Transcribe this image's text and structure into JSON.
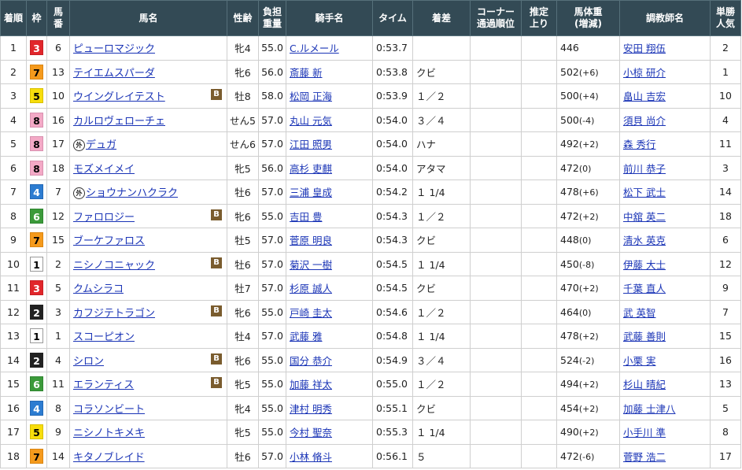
{
  "headers": {
    "rank": "着順",
    "waku": "枠",
    "umaban": "馬\n番",
    "horse": "馬名",
    "sexage": "性齢",
    "weight_carried": "負担\n重量",
    "jockey": "騎手名",
    "time": "タイム",
    "margin": "着差",
    "corner": "コーナー\n通過順位",
    "last3f": "推定\n上り",
    "body_weight": "馬体重\n(増減)",
    "trainer": "調教師名",
    "odds_pop": "単勝\n人気"
  },
  "rows": [
    {
      "rank": "1",
      "waku": "3",
      "umaban": "6",
      "horse": "ピューロマジック",
      "blinker": false,
      "foreign": false,
      "sexage": "牝4",
      "kinryo": "55.0",
      "jockey": "C.ルメール",
      "time": "0:53.7",
      "margin": "",
      "weight": "446",
      "change": "",
      "trainer": "安田 翔伍",
      "pop": "2"
    },
    {
      "rank": "2",
      "waku": "7",
      "umaban": "13",
      "horse": "テイエムスパーダ",
      "blinker": false,
      "foreign": false,
      "sexage": "牝6",
      "kinryo": "56.0",
      "jockey": "斎藤 新",
      "time": "0:53.8",
      "margin": "クビ",
      "weight": "502",
      "change": "(+6)",
      "trainer": "小椋 研介",
      "pop": "1"
    },
    {
      "rank": "3",
      "waku": "5",
      "umaban": "10",
      "horse": "ウイングレイテスト",
      "blinker": true,
      "foreign": false,
      "sexage": "牡8",
      "kinryo": "58.0",
      "jockey": "松岡 正海",
      "time": "0:53.9",
      "margin": "１／２",
      "weight": "500",
      "change": "(+4)",
      "trainer": "畠山 吉宏",
      "pop": "10"
    },
    {
      "rank": "4",
      "waku": "8",
      "umaban": "16",
      "horse": "カルロヴェローチェ",
      "blinker": false,
      "foreign": false,
      "sexage": "せん5",
      "kinryo": "57.0",
      "jockey": "丸山 元気",
      "time": "0:54.0",
      "margin": "３／４",
      "weight": "500",
      "change": "(-4)",
      "trainer": "須貝 尚介",
      "pop": "4"
    },
    {
      "rank": "5",
      "waku": "8",
      "umaban": "17",
      "horse": "デュガ",
      "blinker": false,
      "foreign": true,
      "sexage": "せん6",
      "kinryo": "57.0",
      "jockey": "江田 照男",
      "time": "0:54.0",
      "margin": "ハナ",
      "weight": "492",
      "change": "(+2)",
      "trainer": "森 秀行",
      "pop": "11"
    },
    {
      "rank": "6",
      "waku": "8",
      "umaban": "18",
      "horse": "モズメイメイ",
      "blinker": false,
      "foreign": false,
      "sexage": "牝5",
      "kinryo": "56.0",
      "jockey": "高杉 吏麒",
      "time": "0:54.0",
      "margin": "アタマ",
      "weight": "472",
      "change": "(0)",
      "trainer": "前川 恭子",
      "pop": "3"
    },
    {
      "rank": "7",
      "waku": "4",
      "umaban": "7",
      "horse": "ショウナンハクラク",
      "blinker": false,
      "foreign": true,
      "sexage": "牡6",
      "kinryo": "57.0",
      "jockey": "三浦 皇成",
      "time": "0:54.2",
      "margin": "１ 1/4",
      "weight": "478",
      "change": "(+6)",
      "trainer": "松下 武士",
      "pop": "14"
    },
    {
      "rank": "8",
      "waku": "6",
      "umaban": "12",
      "horse": "ファロロジー",
      "blinker": true,
      "foreign": false,
      "sexage": "牝6",
      "kinryo": "55.0",
      "jockey": "吉田 豊",
      "time": "0:54.3",
      "margin": "１／２",
      "weight": "472",
      "change": "(+2)",
      "trainer": "中舘 英二",
      "pop": "18"
    },
    {
      "rank": "9",
      "waku": "7",
      "umaban": "15",
      "horse": "ブーケファロス",
      "blinker": false,
      "foreign": false,
      "sexage": "牡5",
      "kinryo": "57.0",
      "jockey": "菅原 明良",
      "time": "0:54.3",
      "margin": "クビ",
      "weight": "448",
      "change": "(0)",
      "trainer": "清水 英克",
      "pop": "6"
    },
    {
      "rank": "10",
      "waku": "1",
      "umaban": "2",
      "horse": "ニシノコニャック",
      "blinker": true,
      "foreign": false,
      "sexage": "牡6",
      "kinryo": "57.0",
      "jockey": "菊沢 一樹",
      "time": "0:54.5",
      "margin": "１ 1/4",
      "weight": "450",
      "change": "(-8)",
      "trainer": "伊藤 大士",
      "pop": "12"
    },
    {
      "rank": "11",
      "waku": "3",
      "umaban": "5",
      "horse": "クムシラコ",
      "blinker": false,
      "foreign": false,
      "sexage": "牡7",
      "kinryo": "57.0",
      "jockey": "杉原 誠人",
      "time": "0:54.5",
      "margin": "クビ",
      "weight": "470",
      "change": "(+2)",
      "trainer": "千葉 直人",
      "pop": "9"
    },
    {
      "rank": "12",
      "waku": "2",
      "umaban": "3",
      "horse": "カフジテトラゴン",
      "blinker": true,
      "foreign": false,
      "sexage": "牝6",
      "kinryo": "55.0",
      "jockey": "戸崎 圭太",
      "time": "0:54.6",
      "margin": "１／２",
      "weight": "464",
      "change": "(0)",
      "trainer": "武 英智",
      "pop": "7"
    },
    {
      "rank": "13",
      "waku": "1",
      "umaban": "1",
      "horse": "スコーピオン",
      "blinker": false,
      "foreign": false,
      "sexage": "牡4",
      "kinryo": "57.0",
      "jockey": "武藤 雅",
      "time": "0:54.8",
      "margin": "１ 1/4",
      "weight": "478",
      "change": "(+2)",
      "trainer": "武藤 善則",
      "pop": "15"
    },
    {
      "rank": "14",
      "waku": "2",
      "umaban": "4",
      "horse": "シロン",
      "blinker": true,
      "foreign": false,
      "sexage": "牝6",
      "kinryo": "55.0",
      "jockey": "国分 恭介",
      "time": "0:54.9",
      "margin": "３／４",
      "weight": "524",
      "change": "(-2)",
      "trainer": "小栗 実",
      "pop": "16"
    },
    {
      "rank": "15",
      "waku": "6",
      "umaban": "11",
      "horse": "エランティス",
      "blinker": true,
      "foreign": false,
      "sexage": "牝5",
      "kinryo": "55.0",
      "jockey": "加藤 祥太",
      "time": "0:55.0",
      "margin": "１／２",
      "weight": "494",
      "change": "(+2)",
      "trainer": "杉山 晴紀",
      "pop": "13"
    },
    {
      "rank": "16",
      "waku": "4",
      "umaban": "8",
      "horse": "コラソンビート",
      "blinker": false,
      "foreign": false,
      "sexage": "牝4",
      "kinryo": "55.0",
      "jockey": "津村 明秀",
      "time": "0:55.1",
      "margin": "クビ",
      "weight": "454",
      "change": "(+2)",
      "trainer": "加藤 士津八",
      "pop": "5"
    },
    {
      "rank": "17",
      "waku": "5",
      "umaban": "9",
      "horse": "ニシノトキメキ",
      "blinker": false,
      "foreign": false,
      "sexage": "牝5",
      "kinryo": "55.0",
      "jockey": "今村 聖奈",
      "time": "0:55.3",
      "margin": "１ 1/4",
      "weight": "490",
      "change": "(+2)",
      "trainer": "小手川 準",
      "pop": "8"
    },
    {
      "rank": "18",
      "waku": "7",
      "umaban": "14",
      "horse": "キタノブレイド",
      "blinker": false,
      "foreign": false,
      "sexage": "牡6",
      "kinryo": "57.0",
      "jockey": "小林 脩斗",
      "time": "0:56.1",
      "margin": "５",
      "weight": "472",
      "change": "(-6)",
      "trainer": "菅野 浩二",
      "pop": "17"
    }
  ],
  "badges": {
    "blinker": "B",
    "foreign": "外"
  },
  "waku_colors": {
    "1": "#ffffff",
    "2": "#222222",
    "3": "#e1262b",
    "4": "#2c7cd1",
    "5": "#f7dd0c",
    "6": "#3b9a3a",
    "7": "#f59a1c",
    "8": "#f3a9c6"
  }
}
